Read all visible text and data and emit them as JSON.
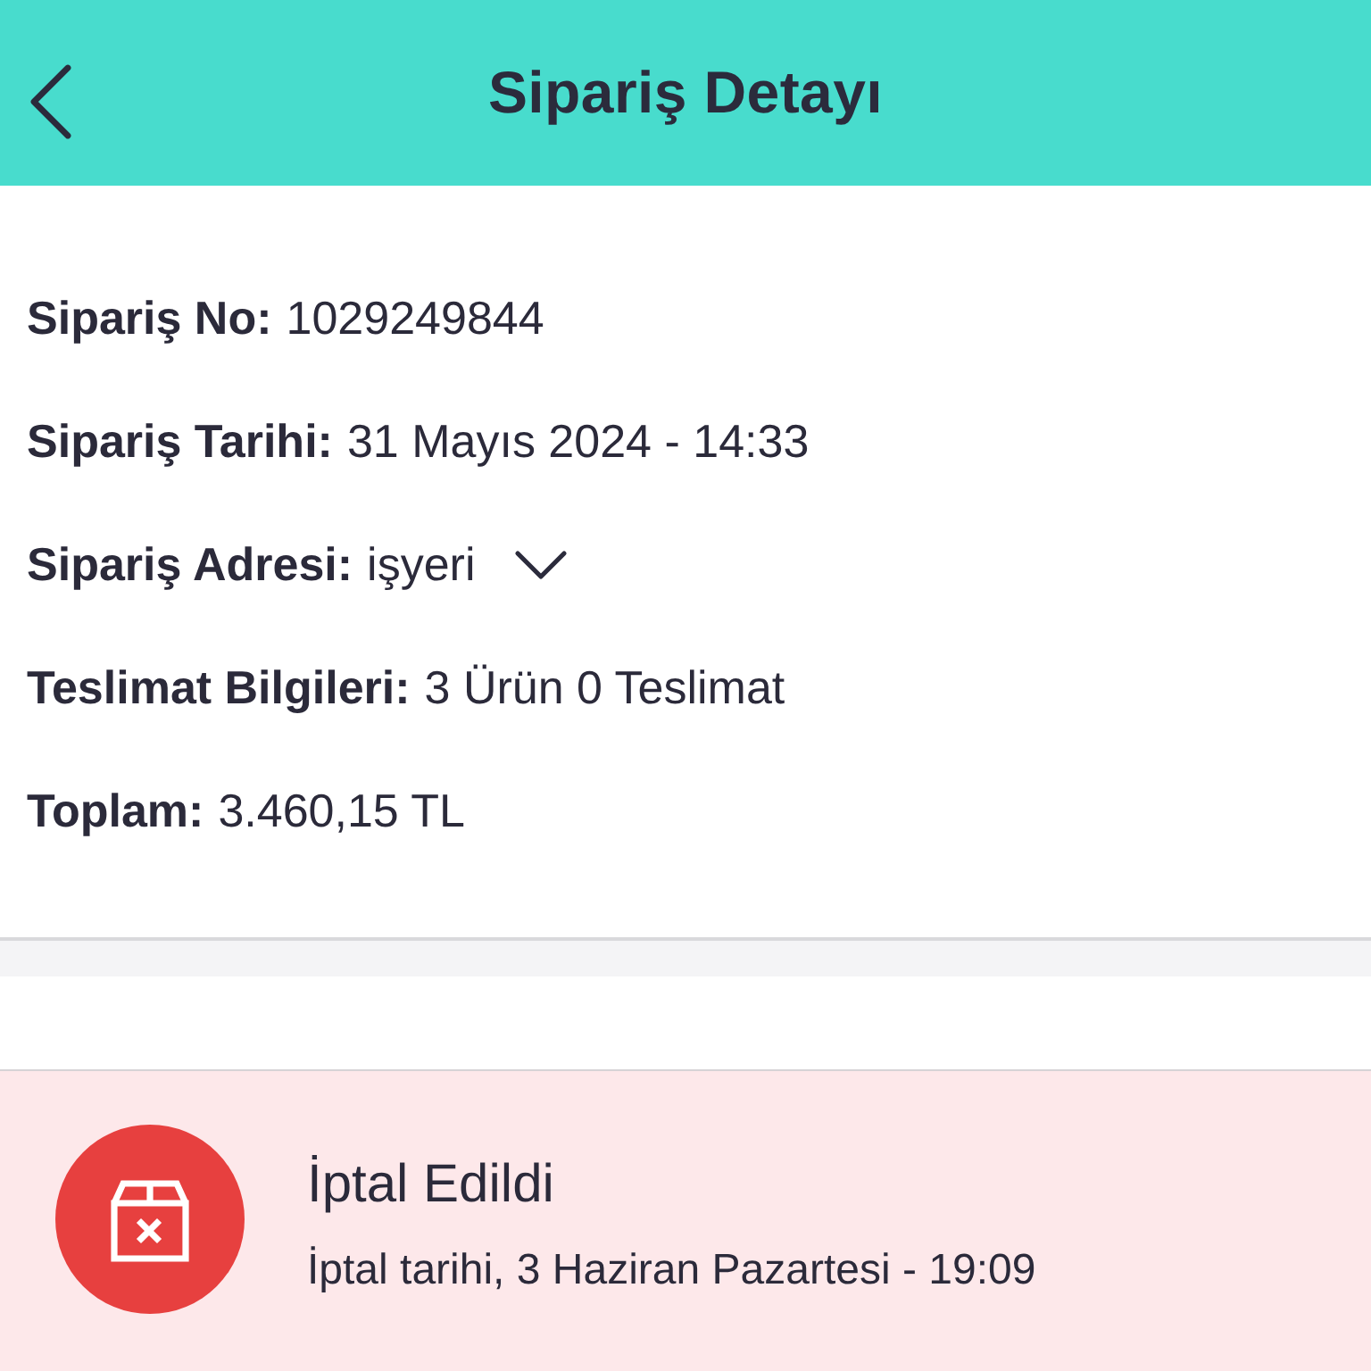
{
  "header": {
    "title": "Sipariş Detayı"
  },
  "order_info": [
    {
      "kind": "text",
      "label": "Sipariş No:",
      "value": "1029249844"
    },
    {
      "kind": "text",
      "label": "Sipariş Tarihi:",
      "value": "31 Mayıs 2024 - 14:33"
    },
    {
      "kind": "dropdown",
      "label": "Sipariş Adresi:",
      "value": "işyeri",
      "expanded": false
    },
    {
      "kind": "text",
      "label": "Teslimat Bilgileri:",
      "value": "3 Ürün 0 Teslimat"
    },
    {
      "kind": "text",
      "label": "Toplam:",
      "value": "3.460,15 TL"
    }
  ],
  "status": {
    "kind": "cancelled",
    "title": "İptal Edildi",
    "subtitle": "İptal tarihi, 3 Haziran Pazartesi - 19:09"
  }
}
